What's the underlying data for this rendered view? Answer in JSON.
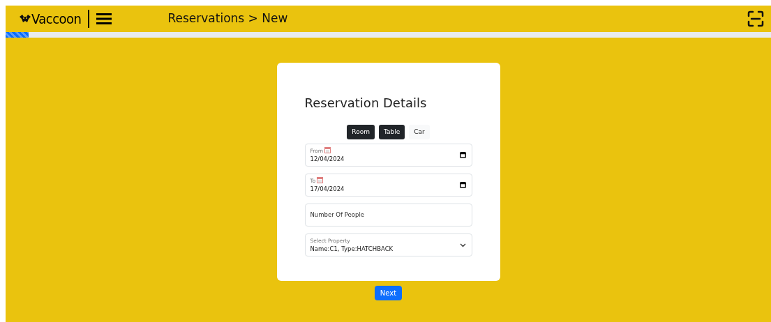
{
  "header": {
    "brand": "Vaccoon",
    "breadcrumb": "Reservations > New"
  },
  "progress": {
    "level": 0.03
  },
  "form": {
    "title": "Reservation Details",
    "tabs": [
      {
        "label": "Room",
        "selected": true
      },
      {
        "label": "Table",
        "selected": true
      },
      {
        "label": "Car",
        "selected": false
      }
    ],
    "fields": [
      {
        "kind": "date",
        "label": "From",
        "value": "12/04/2024"
      },
      {
        "kind": "date",
        "label": "To",
        "value": "17/04/2024"
      },
      {
        "kind": "number",
        "placeholder": "Number Of People"
      },
      {
        "kind": "select",
        "label": "Select Property",
        "value": "Name:C1, Type:HATCHBACK"
      }
    ]
  },
  "next_button": "Next"
}
